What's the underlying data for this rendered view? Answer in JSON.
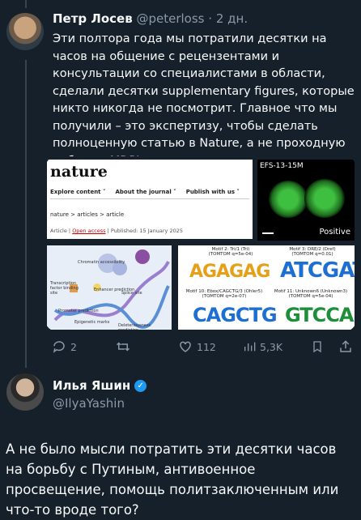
{
  "tweet1": {
    "author_name": "Петр Лосев",
    "handle": "@peterloss",
    "separator": "·",
    "time": "2 дн.",
    "text": "Эти полтора года мы потратили десятки на часов на общение с рецензентами и консультации со специалистами в области,  сделали десятки supplementary figures, которые никто никогда не посмотрит. Главное что  мы получили – это экспертизу, чтобы сделать полноценную статью в Nature, а не проходную работу в MDPI",
    "media": {
      "nature": {
        "logo": "nature",
        "nav": [
          "Explore content ˅",
          "About the journal ˅",
          "Publish with us ˅"
        ],
        "breadcrumb": "nature  >  articles  >  article",
        "meta_prefix": "Article | ",
        "open_access": "Open access",
        "meta_suffix": " | Published: 15 January 2025"
      },
      "efs": {
        "label": "EFS-13-15M",
        "badge": "Positive"
      },
      "chromatin": {
        "labels": [
          "Chromatin accessibility",
          "Transcription factor binding site",
          "Enhancer prediction",
          "Splice site",
          "Promoter prediction",
          "Epigenetic marks",
          "Deleteriousness prediction"
        ]
      },
      "motifs": [
        {
          "title": "Motif 2: Tri/1 (Tri)",
          "sub": "(TOMTOM q=5e-04)",
          "seq": "AGAGAG"
        },
        {
          "title": "Motif 3: DRE/2 (Dref)",
          "sub": "(TOMTOM q=0.01)",
          "seq": "ATCGATA"
        },
        {
          "title": "Motif 10: Ebox/CAGCTG/3 (Ohler5)",
          "sub": "(TOMTOM q=2e-07)",
          "seq": "CAGCTG"
        },
        {
          "title": "Motif 11: Unknown6 (Unknown3)",
          "sub": "(TOMTOM q=5e-04)",
          "seq": "GTCCA"
        }
      ]
    },
    "actions": {
      "replies": "2",
      "retweets": "",
      "likes": "112",
      "views": "5,3K"
    }
  },
  "tweet2": {
    "author_name": "Илья Яшин",
    "handle": "@IlyaYashin",
    "text": "А не было мысли потратить эти десятки часов на борьбу с Путиным, антивоенное просвещение, помощь политзаключенным или что-то вроде того?"
  },
  "colors": {
    "background": "#15202b",
    "text": "#f7f9f9",
    "muted": "#8b98a5",
    "verified": "#1d9bf0"
  }
}
